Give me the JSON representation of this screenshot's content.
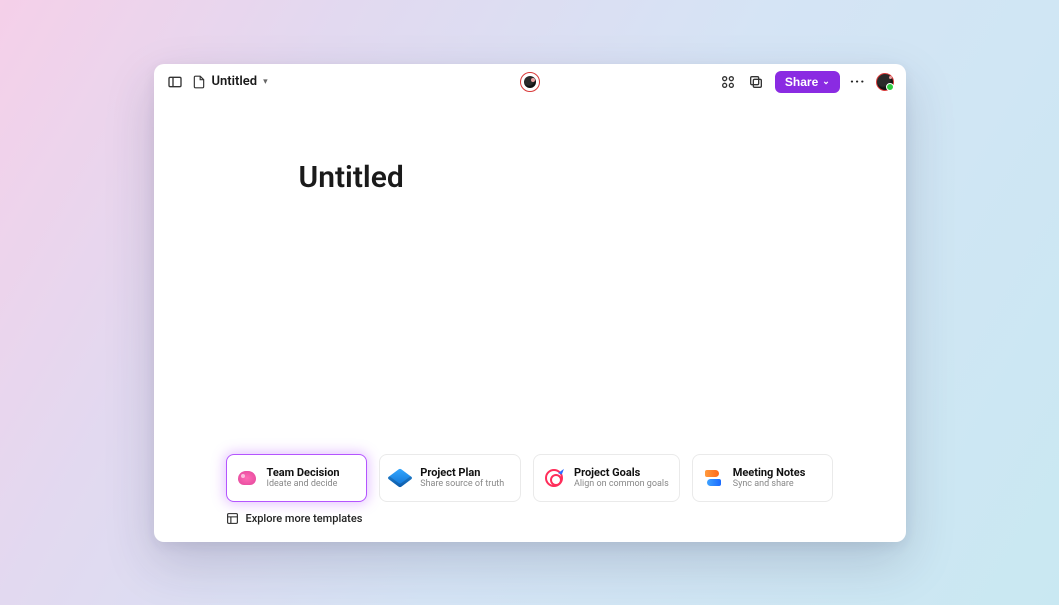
{
  "header": {
    "doc_title": "Untitled",
    "share_label": "Share"
  },
  "page": {
    "title": "Untitled"
  },
  "templates": [
    {
      "title": "Team Decision",
      "subtitle": "Ideate and decide",
      "icon": "brain",
      "active": true
    },
    {
      "title": "Project Plan",
      "subtitle": "Share source of truth",
      "icon": "cube",
      "active": false
    },
    {
      "title": "Project Goals",
      "subtitle": "Align on common goals",
      "icon": "target",
      "active": false
    },
    {
      "title": "Meeting Notes",
      "subtitle": "Sync and share",
      "icon": "fish",
      "active": false
    }
  ],
  "explore_label": "Explore more templates"
}
